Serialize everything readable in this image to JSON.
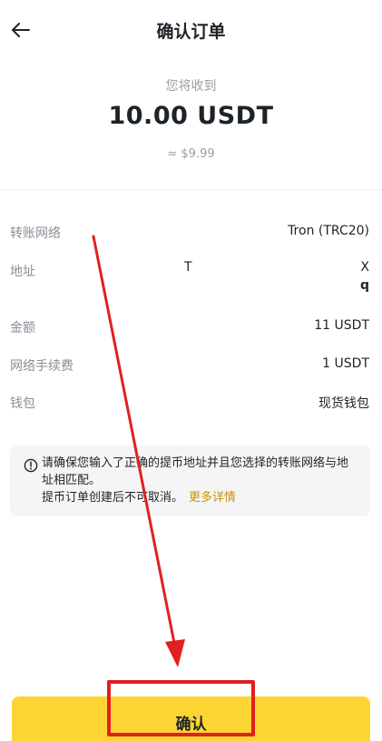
{
  "header": {
    "title": "确认订单",
    "back_icon": "arrow-left-icon"
  },
  "summary": {
    "label": "您将收到",
    "amount": "10.00 USDT",
    "approx": "≈ $9.99"
  },
  "details": {
    "network_label": "转账网络",
    "network_value": "Tron (TRC20)",
    "address_label": "地址",
    "address_start": "T",
    "address_end": "X",
    "address_line2": "q",
    "amount_label": "金额",
    "amount_value": "11 USDT",
    "fee_label": "网络手续费",
    "fee_value": "1 USDT",
    "wallet_label": "钱包",
    "wallet_value": "现货钱包"
  },
  "notice": {
    "icon": "info-circle-icon",
    "line1": "请确保您输入了正确的提币地址并且您选择的转账网络与地址相匹配。",
    "line2": "提币订单创建后不可取消。",
    "more_link": "更多详情"
  },
  "confirm": {
    "label": "确认"
  },
  "colors": {
    "accent": "#fcd535",
    "annotation": "#e02020",
    "link": "#c99400"
  }
}
